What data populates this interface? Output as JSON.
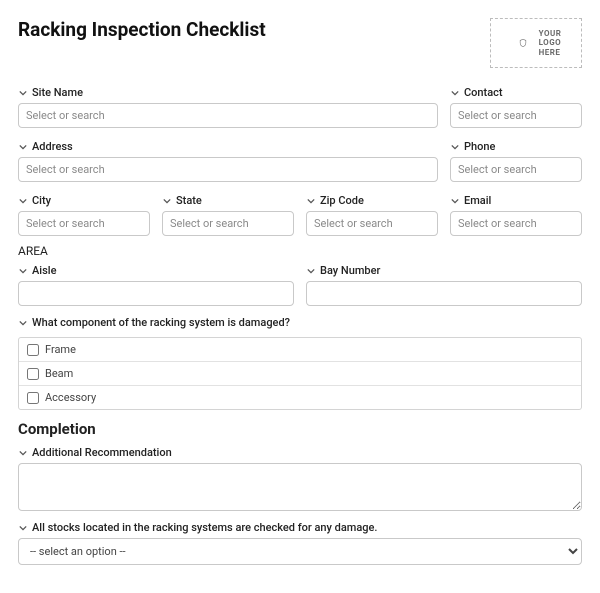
{
  "header": {
    "title": "Racking Inspection Checklist",
    "logo_line1": "YOUR",
    "logo_line2": "LOGO",
    "logo_line3": "HERE"
  },
  "fields": {
    "site_name": {
      "label": "Site Name",
      "placeholder": "Select or search",
      "value": ""
    },
    "contact": {
      "label": "Contact",
      "placeholder": "Select or search",
      "value": ""
    },
    "address": {
      "label": "Address",
      "placeholder": "Select or search",
      "value": ""
    },
    "phone": {
      "label": "Phone",
      "placeholder": "Select or search",
      "value": ""
    },
    "city": {
      "label": "City",
      "placeholder": "Select or search",
      "value": ""
    },
    "state": {
      "label": "State",
      "placeholder": "Select or search",
      "value": ""
    },
    "zip": {
      "label": "Zip Code",
      "placeholder": "Select or search",
      "value": ""
    },
    "email": {
      "label": "Email",
      "placeholder": "Select or search",
      "value": ""
    }
  },
  "area": {
    "heading": "AREA",
    "aisle": {
      "label": "Aisle",
      "value": ""
    },
    "bay": {
      "label": "Bay Number",
      "value": ""
    }
  },
  "damage": {
    "question": "What component of the racking system is damaged?",
    "options": [
      {
        "label": "Frame",
        "checked": false
      },
      {
        "label": "Beam",
        "checked": false
      },
      {
        "label": "Accessory",
        "checked": false
      }
    ]
  },
  "completion": {
    "heading": "Completion",
    "recommendation": {
      "label": "Additional Recommendation",
      "value": ""
    },
    "stocks_checked": {
      "label": "All stocks located in the racking systems are checked for any damage.",
      "placeholder_option": "-- select an option --",
      "value": ""
    }
  }
}
